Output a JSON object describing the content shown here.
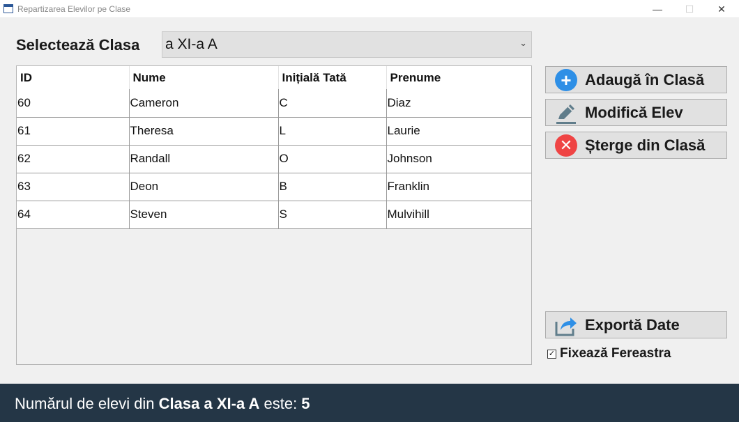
{
  "window": {
    "title": "Repartizarea Elevilor pe Clase",
    "minimize": "—",
    "maximize": "☐",
    "close": "✕"
  },
  "selector": {
    "label": "Selectează Clasa",
    "value": "a XI-a A"
  },
  "table": {
    "columns": [
      "ID",
      "Nume",
      "Inițială Tată",
      "Prenume"
    ],
    "rows": [
      [
        "60",
        "Cameron",
        "C",
        "Diaz"
      ],
      [
        "61",
        "Theresa",
        "L",
        "Laurie"
      ],
      [
        "62",
        "Randall",
        "O",
        "Johnson"
      ],
      [
        "63",
        "Deon",
        "B",
        "Franklin"
      ],
      [
        "64",
        "Steven",
        "S",
        "Mulvihill"
      ]
    ]
  },
  "actions": {
    "add": {
      "label": "Adaugă în Clasă",
      "icon": "plus-circle-icon",
      "color": "#2e8fe6"
    },
    "edit": {
      "label": "Modifică Elev",
      "icon": "pencil-icon",
      "color": "#607d8b"
    },
    "delete": {
      "label": "Șterge din Clasă",
      "icon": "close-circle-icon",
      "color": "#ef4444"
    },
    "export": {
      "label": "Exportă Date",
      "icon": "export-share-icon",
      "color": "#2e8fe6"
    }
  },
  "lock_window": {
    "label": "Fixează Fereastra",
    "checked": true,
    "check_mark": "✓"
  },
  "status": {
    "prefix": "Numărul de elevi din ",
    "class_name": "Clasa a XI-a A",
    "middle": " este: ",
    "count": "5"
  },
  "colors": {
    "status_bar": "#243646",
    "window_bg": "#f0f0f0",
    "button_bg": "#e1e1e1"
  }
}
